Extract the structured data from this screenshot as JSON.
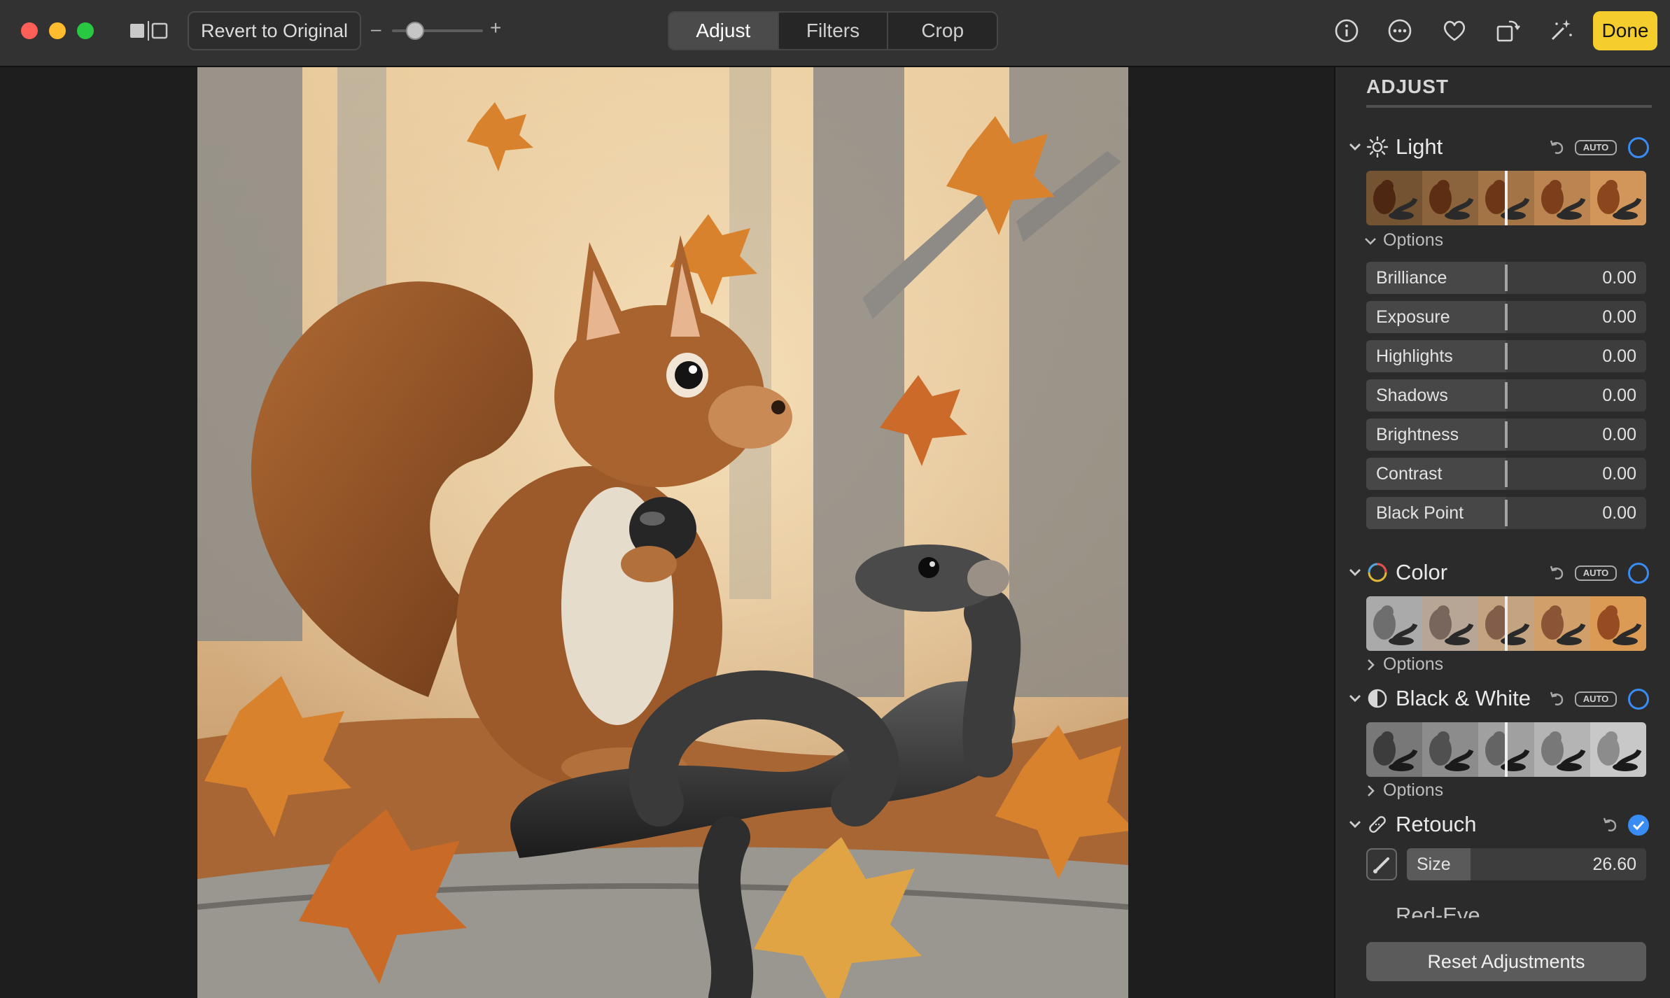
{
  "toolbar": {
    "revert_label": "Revert to Original",
    "zoom_minus": "–",
    "zoom_plus": "+",
    "zoom_level": 0.25,
    "tabs": [
      {
        "label": "Adjust",
        "active": true
      },
      {
        "label": "Filters",
        "active": false
      },
      {
        "label": "Crop",
        "active": false
      }
    ],
    "icons": [
      "info-icon",
      "more-icon",
      "heart-icon",
      "rotate-icon",
      "magic-wand-icon"
    ],
    "done_label": "Done",
    "accent_color": "#f5cd2d"
  },
  "sidebar": {
    "title": "ADJUST",
    "sections": {
      "light": {
        "label": "Light",
        "auto": "AUTO",
        "options_label": "Options",
        "options_expanded": true,
        "sliders": [
          {
            "label": "Brilliance",
            "value": "0.00"
          },
          {
            "label": "Exposure",
            "value": "0.00"
          },
          {
            "label": "Highlights",
            "value": "0.00"
          },
          {
            "label": "Shadows",
            "value": "0.00"
          },
          {
            "label": "Brightness",
            "value": "0.00"
          },
          {
            "label": "Contrast",
            "value": "0.00"
          },
          {
            "label": "Black Point",
            "value": "0.00"
          }
        ]
      },
      "color": {
        "label": "Color",
        "auto": "AUTO",
        "options_label": "Options",
        "options_expanded": false
      },
      "bw": {
        "label": "Black & White",
        "auto": "AUTO",
        "options_label": "Options",
        "options_expanded": false
      },
      "retouch": {
        "label": "Retouch",
        "enabled": true,
        "size_label": "Size",
        "size_value": "26.60",
        "size_fraction": 0.266
      },
      "red_eye": {
        "label": "Red-Eye"
      }
    },
    "reset_label": "Reset Adjustments",
    "toggle_color": "#3a8cf5"
  }
}
